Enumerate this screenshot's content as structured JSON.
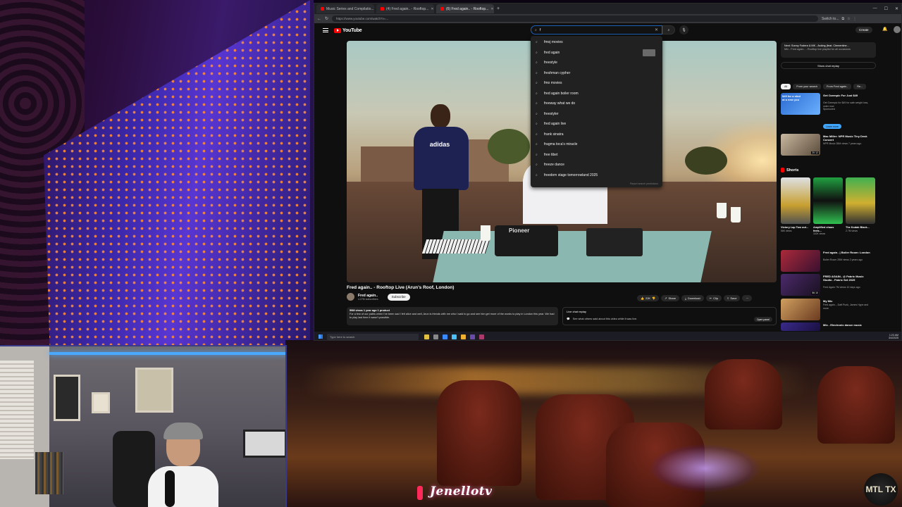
{
  "browser": {
    "tabs": [
      {
        "label": "Music Series and Compilatio..."
      },
      {
        "label": "(4) Fred again.. - Rooftop..."
      },
      {
        "label": "(6) Fred again.. - Rooftop..."
      }
    ],
    "url": "https://www.youtube.com/watch?v=...",
    "toolbar_label": "Switch to..."
  },
  "youtube": {
    "logo_text": "YouTube",
    "search_value": "f",
    "create_label": "Create",
    "suggestions": [
      "fmoj movies",
      "fred again",
      "freestyle",
      "freshman cypher",
      "fmo movies",
      "fred again boiler room",
      "freeway what we do",
      "freestyler",
      "fred again live",
      "frank sinatra",
      "fragma toca's miracle",
      "free tibet",
      "freeze dance",
      "freedom stage tomorrowland 2025"
    ],
    "report_text": "Report search predictions"
  },
  "video": {
    "overlay_logo": "adidas",
    "deck_label": "Pioneer",
    "title": "Fred again.. - Rooftop Live (Arun's Roof, London)",
    "channel": "Fred again..",
    "channel_subs": "4.27M subscribers",
    "subscribe_label": "Subscribe",
    "likes": "22K",
    "share_label": "Share",
    "download_label": "Download",
    "clip_label": "Clip",
    "save_label": "Save",
    "description_meta": "59M views  1 year ago  1 product",
    "description_text": "For a few of our paths when I've been sad I felt alive and well, Arun is friends with me who I said to go and see him get more of the words to play in London this year. We had to play last time it wasn't possible.",
    "chat_title": "Live chat replay",
    "chat_sub": "See what others said about this video while it was live.",
    "chat_open": "Open panel"
  },
  "sidebar": {
    "live_card_line1": "Next: Sonny Fodera & MK - Asking (feat. Clementine...",
    "live_card_line2": "Mix - Fred again.. - Rooftop live playlist for all occasions",
    "replay_label": "Show chat replay",
    "chips": [
      "All",
      "From your search",
      "From Fred again..",
      "Re..."
    ],
    "ad": {
      "title": "Get Ozempic For Just $49",
      "badge": "$49 for a shot at a new you",
      "meta": "Get Ozempic for $49 for safe weight loss, order now",
      "sponsor": "Sponsored",
      "button": "Learn more"
    },
    "rec1": {
      "title": "Mac Miller: NPR Music Tiny Desk Concert",
      "meta": "NPR Music  35M views  7 years ago",
      "duration": "20:12"
    },
    "shorts_label": "Shorts",
    "shorts": [
      {
        "title": "Victory Lap Two out...",
        "views": "56K views"
      },
      {
        "title": "Amplified chaos feels...",
        "views": "110K views"
      },
      {
        "title": "The Kodak Black...",
        "views": "2.7M views"
      }
    ],
    "rec2": {
      "title": "Fred again.. | Boiler Room: London",
      "meta": "Boiler Room  25M views  2 years ago"
    },
    "rec3": {
      "title": "FRED AGAIN.. @ Fabric Music Studio - Fabric Set 2025",
      "meta": "Fred Again  7M views  10 days ago",
      "duration": "56:10"
    },
    "rec4": {
      "title": "My Mix",
      "meta": "Fred again.., Daft Punk, James Hype and more"
    },
    "rec5": {
      "title": "Mix - Electronic dance music"
    }
  },
  "taskbar": {
    "search_placeholder": "Type here to search",
    "time": "1:23 AM",
    "date": "3/4/2025"
  },
  "overlay": {
    "watermark": "Jenellotv",
    "badge_logo": "MTL TX"
  },
  "colors": {
    "yt_red": "#ff0000",
    "yt_bg": "#0f0f0f",
    "accent_blue": "#3ea6ff"
  }
}
